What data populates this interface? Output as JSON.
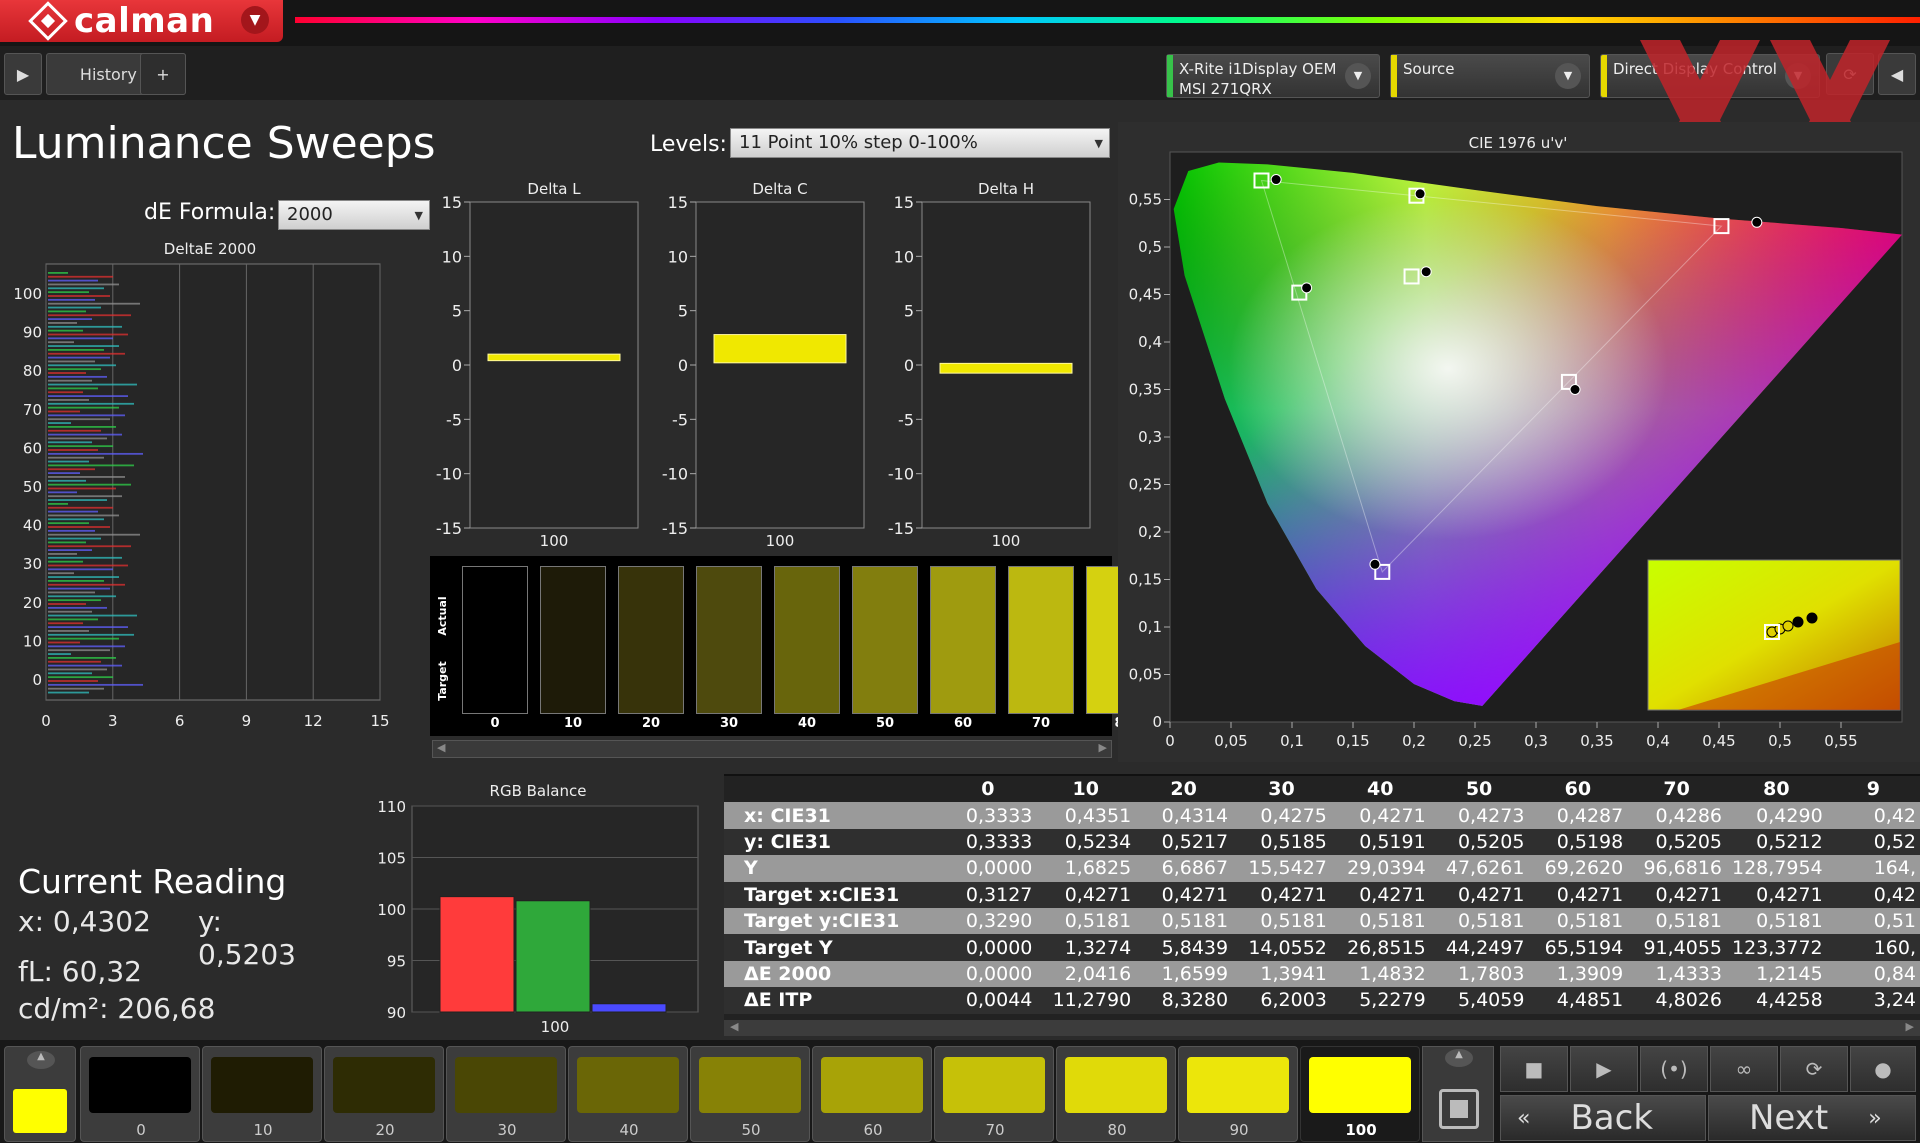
{
  "app": {
    "logo_text": "calman",
    "tab_history": "History 1",
    "tab_add": "+",
    "meter": "X-Rite i1Display OEM",
    "meter_sub": "MSI 271QRX",
    "source": "Source",
    "direct": "Direct Display Control",
    "accent": "#d42a2e"
  },
  "page": {
    "title": "Luminance Sweeps",
    "de_formula_label": "dE Formula:",
    "de_formula_value": "2000",
    "levels_label": "Levels:",
    "levels_value": "11 Point 10% step 0-100%"
  },
  "deltae": {
    "title": "DeltaE 2000",
    "x_ticks": [
      "0",
      "3",
      "6",
      "9",
      "12",
      "15"
    ],
    "y_ticks": [
      "0",
      "10",
      "20",
      "30",
      "40",
      "50",
      "60",
      "70",
      "80",
      "90",
      "100"
    ]
  },
  "delta_charts": [
    {
      "title": "Delta L",
      "value": 0.7,
      "thickness": 0.6,
      "category": "100"
    },
    {
      "title": "Delta C",
      "value": 1.5,
      "thickness": 2.6,
      "category": "100"
    },
    {
      "title": "Delta H",
      "value": -0.3,
      "thickness": 0.9,
      "category": "100"
    }
  ],
  "delta_y_ticks": [
    "15",
    "10",
    "5",
    "0",
    "-5",
    "-10",
    "-15"
  ],
  "swatches": {
    "actual_label": "Actual",
    "target_label": "Target",
    "items": [
      {
        "label": "0",
        "color": "#000000"
      },
      {
        "label": "10",
        "color": "#1e1b08"
      },
      {
        "label": "20",
        "color": "#37330a"
      },
      {
        "label": "30",
        "color": "#4e4a0d"
      },
      {
        "label": "40",
        "color": "#68650c"
      },
      {
        "label": "50",
        "color": "#827e0e"
      },
      {
        "label": "60",
        "color": "#9f9b0f"
      },
      {
        "label": "70",
        "color": "#bcb810"
      },
      {
        "label": "8",
        "color": "#d5d110"
      }
    ]
  },
  "cie": {
    "title": "CIE 1976 u'v'",
    "x_ticks": [
      "0",
      "0,05",
      "0,1",
      "0,15",
      "0,2",
      "0,25",
      "0,3",
      "0,35",
      "0,4",
      "0,45",
      "0,5",
      "0,55"
    ],
    "y_ticks": [
      "0",
      "0,05",
      "0,1",
      "0,15",
      "0,2",
      "0,25",
      "0,3",
      "0,35",
      "0,4",
      "0,45",
      "0,5",
      "0,55"
    ],
    "targets": [
      {
        "u": 0.075,
        "v": 0.57
      },
      {
        "u": 0.202,
        "v": 0.554
      },
      {
        "u": 0.452,
        "v": 0.522
      },
      {
        "u": 0.198,
        "v": 0.469
      },
      {
        "u": 0.106,
        "v": 0.452
      },
      {
        "u": 0.327,
        "v": 0.358
      },
      {
        "u": 0.174,
        "v": 0.158
      }
    ],
    "measured": [
      {
        "u": 0.087,
        "v": 0.571
      },
      {
        "u": 0.205,
        "v": 0.556
      },
      {
        "u": 0.481,
        "v": 0.526
      },
      {
        "u": 0.21,
        "v": 0.474
      },
      {
        "u": 0.112,
        "v": 0.457
      },
      {
        "u": 0.332,
        "v": 0.35
      },
      {
        "u": 0.168,
        "v": 0.166
      }
    ]
  },
  "current": {
    "title": "Current Reading",
    "x": "x: 0,4302",
    "y": "y: 0,5203",
    "fl": "fL: 60,32",
    "cdm": "cd/m²: 206,68"
  },
  "rgb": {
    "title": "RGB Balance",
    "y_ticks": [
      "110",
      "105",
      "100",
      "95",
      "90"
    ],
    "ylim": [
      90,
      110
    ],
    "category": "100",
    "bars": [
      {
        "name": "red",
        "value": 101.2,
        "color": "#ff3b3b"
      },
      {
        "name": "green",
        "value": 100.8,
        "color": "#2fa83a"
      },
      {
        "name": "blue",
        "value": 90.8,
        "color": "#4a4aff"
      }
    ]
  },
  "table": {
    "columns": [
      "0",
      "10",
      "20",
      "30",
      "40",
      "50",
      "60",
      "70",
      "80",
      "9"
    ],
    "rows": [
      {
        "label": "x: CIE31",
        "values": [
          "0,3333",
          "0,4351",
          "0,4314",
          "0,4275",
          "0,4271",
          "0,4273",
          "0,4287",
          "0,4286",
          "0,4290",
          "0,42"
        ]
      },
      {
        "label": "y: CIE31",
        "values": [
          "0,3333",
          "0,5234",
          "0,5217",
          "0,5185",
          "0,5191",
          "0,5205",
          "0,5198",
          "0,5205",
          "0,5212",
          "0,52"
        ]
      },
      {
        "label": "Y",
        "values": [
          "0,0000",
          "1,6825",
          "6,6867",
          "15,5427",
          "29,0394",
          "47,6261",
          "69,2620",
          "96,6816",
          "128,7954",
          "164,"
        ]
      },
      {
        "label": "Target x:CIE31",
        "values": [
          "0,3127",
          "0,4271",
          "0,4271",
          "0,4271",
          "0,4271",
          "0,4271",
          "0,4271",
          "0,4271",
          "0,4271",
          "0,42"
        ]
      },
      {
        "label": "Target y:CIE31",
        "values": [
          "0,3290",
          "0,5181",
          "0,5181",
          "0,5181",
          "0,5181",
          "0,5181",
          "0,5181",
          "0,5181",
          "0,5181",
          "0,51"
        ]
      },
      {
        "label": "Target Y",
        "values": [
          "0,0000",
          "1,3274",
          "5,8439",
          "14,0552",
          "26,8515",
          "44,2497",
          "65,5194",
          "91,4055",
          "123,3772",
          "160,"
        ]
      },
      {
        "label": "ΔE 2000",
        "values": [
          "0,0000",
          "2,0416",
          "1,6599",
          "1,3941",
          "1,4832",
          "1,7803",
          "1,3909",
          "1,4333",
          "1,2145",
          "0,84"
        ]
      },
      {
        "label": "ΔE ITP",
        "values": [
          "0,0044",
          "11,2790",
          "8,3280",
          "6,2003",
          "5,2279",
          "5,4059",
          "4,4851",
          "4,8026",
          "4,4258",
          "3,24"
        ]
      }
    ]
  },
  "bottom": {
    "swatches": [
      {
        "label": "0",
        "color": "#000000"
      },
      {
        "label": "10",
        "color": "#1f1c03"
      },
      {
        "label": "20",
        "color": "#2e2c04"
      },
      {
        "label": "30",
        "color": "#4a4705"
      },
      {
        "label": "40",
        "color": "#6a6606"
      },
      {
        "label": "50",
        "color": "#878206"
      },
      {
        "label": "60",
        "color": "#a8a307"
      },
      {
        "label": "70",
        "color": "#c6c108"
      },
      {
        "label": "80",
        "color": "#e0da09"
      },
      {
        "label": "90",
        "color": "#ece60a"
      },
      {
        "label": "100",
        "color": "#ffff00"
      }
    ],
    "back_label": "Back",
    "next_label": "Next"
  }
}
